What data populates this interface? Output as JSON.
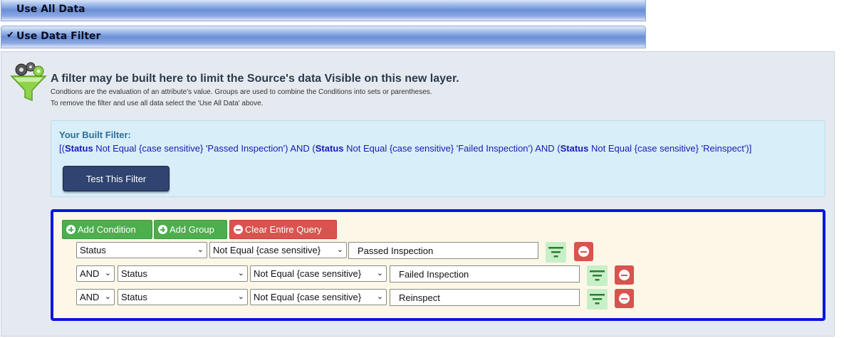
{
  "accordion": {
    "use_all_label": "Use All Data",
    "use_filter_label": "Use Data Filter",
    "selected_check": "✔"
  },
  "header": {
    "title": "A filter may be built here to limit the Source's data Visible on this new layer.",
    "desc1": "Condtions are the evaluation of an attribute's value. Groups are used to combine the Conditions into sets or parentheses.",
    "desc2": "To remove the filter and use all data select the 'Use All Data' above."
  },
  "built_filter": {
    "label": "Your Built Filter:",
    "parts": [
      "[(",
      "Status",
      " Not Equal {case sensitive} 'Passed Inspection') AND (",
      "Status",
      " Not Equal {case sensitive} 'Failed Inspection') AND (",
      "Status",
      " Not Equal {case sensitive} 'Reinspect')]"
    ],
    "test_button": "Test This Filter"
  },
  "query": {
    "add_condition": "Add Condition",
    "add_group": "Add Group",
    "clear_query": "Clear Entire Query",
    "rows": [
      {
        "join": "",
        "field": "Status",
        "operator": "Not Equal {case sensitive}",
        "value": "Passed Inspection"
      },
      {
        "join": "AND",
        "field": "Status",
        "operator": "Not Equal {case sensitive}",
        "value": "Failed Inspection"
      },
      {
        "join": "AND",
        "field": "Status",
        "operator": "Not Equal {case sensitive}",
        "value": "Reinspect"
      }
    ]
  },
  "icons": {
    "funnel": "funnel-gears-icon",
    "filter": "filter-lines-icon",
    "remove": "minus-circle-icon",
    "add": "plus-circle-icon"
  },
  "colors": {
    "query_border": "#0a14e6",
    "test_button": "#2f4470",
    "green_button": "#4cae4c",
    "red_button": "#d9534f"
  }
}
